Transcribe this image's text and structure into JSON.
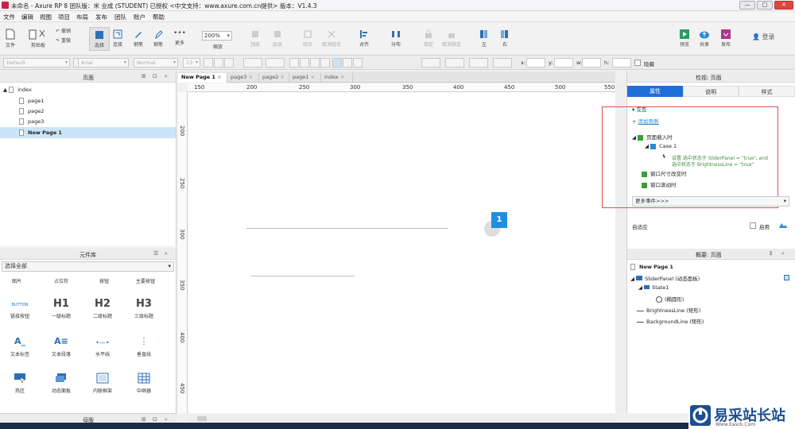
{
  "window": {
    "title": "未命名 - Axure RP 8 团队版：米 业成 (STUDENT) 已授权    <中文支持：www.axure.com.cn提供> 版本：V1.4.3",
    "min": "—",
    "max": "□",
    "close": "✕"
  },
  "menu": [
    "文件",
    "编辑",
    "视图",
    "项目",
    "布局",
    "发布",
    "团队",
    "账户",
    "帮助"
  ],
  "toolbar": {
    "file": "文件",
    "clipboard": "剪贴板",
    "undo": "撤销",
    "redo": "重做",
    "select": "选择",
    "connect": "连接",
    "pen": "钢笔",
    "more": "更多",
    "zoom_value": "200%",
    "zoom_label": "缩放",
    "top": "顶层",
    "bottom": "底层",
    "group": "组合",
    "ungroup": "取消组合",
    "align": "对齐",
    "distribute": "分布",
    "lock": "锁定",
    "unlock": "取消锁定",
    "left": "左",
    "right": "右",
    "preview": "预览",
    "share": "共享",
    "publish": "发布",
    "login": "登录"
  },
  "format": {
    "style": "Default",
    "font": "Arial",
    "weight": "Normal",
    "size": "13",
    "x_label": "x:",
    "y_label": "y:",
    "w_label": "w:",
    "h_label": "h:",
    "hidden": "隐藏"
  },
  "pages": {
    "header": "页面",
    "items": [
      "index",
      "page1",
      "page2",
      "page3",
      "New Page 1"
    ]
  },
  "library": {
    "header": "元件库",
    "select_all": "选择全部",
    "top_row": [
      "图片",
      "占位符",
      "按钮",
      "主要按钮"
    ],
    "widgets": [
      {
        "glyph": "BUTTON",
        "label": "链接按钮"
      },
      {
        "glyph": "H1",
        "label": "一级标题"
      },
      {
        "glyph": "H2",
        "label": "二级标题"
      },
      {
        "glyph": "H3",
        "label": "三级标题"
      },
      {
        "glyph": "A_",
        "label": "文本标签"
      },
      {
        "glyph": "A≡",
        "label": "文本段落"
      },
      {
        "glyph": "•—•",
        "label": "水平线"
      },
      {
        "glyph": "⋮",
        "label": "垂直线"
      },
      {
        "glyph": "",
        "label": "热区"
      },
      {
        "glyph": "",
        "label": "动态面板"
      },
      {
        "glyph": "",
        "label": "内联框架"
      },
      {
        "glyph": "",
        "label": "中继器"
      }
    ]
  },
  "masters": {
    "header": "母版"
  },
  "tabs": [
    "New Page 1",
    "page3",
    "page2",
    "page1",
    "index"
  ],
  "ruler": {
    "h": [
      "150",
      "200",
      "250",
      "300",
      "350",
      "400",
      "450",
      "500",
      "550"
    ],
    "v": [
      "200",
      "250",
      "300",
      "350",
      "400",
      "450"
    ]
  },
  "canvas": {
    "badge": "1"
  },
  "inspector": {
    "header": "检视: 页面",
    "tab_props": "属性",
    "tab_notes": "说明",
    "tab_style": "样式",
    "section": "交互",
    "add_case": "添加用例",
    "on_load": "页面载入时",
    "case1": "Case 1",
    "action_line1": "设置 选中状态于 SliderPanel = \"true\", and",
    "action_line2": "选中状态于 BrightnessLine = \"true\"",
    "on_resize": "窗口尺寸改变时",
    "on_scroll": "窗口滚动时",
    "more_events": "更多事件>>>",
    "adaptive": "自适应",
    "enable": "启用"
  },
  "outline": {
    "header": "概要: 页面",
    "page": "New Page 1",
    "slider": "SliderPanel (动态面板)",
    "state1": "State1",
    "ellipse": "(椭圆形)",
    "brightness": "BrightnessLine (矩形)",
    "background": "BackgroundLine (矩形)"
  },
  "watermark": {
    "main": "易采站长站",
    "sub": "Www.Easck.Com"
  },
  "colors": {
    "accent": "#1e6fd9",
    "highlight_box": "#e05050",
    "green": "#3a9f3a",
    "badge": "#1e8fe0"
  }
}
